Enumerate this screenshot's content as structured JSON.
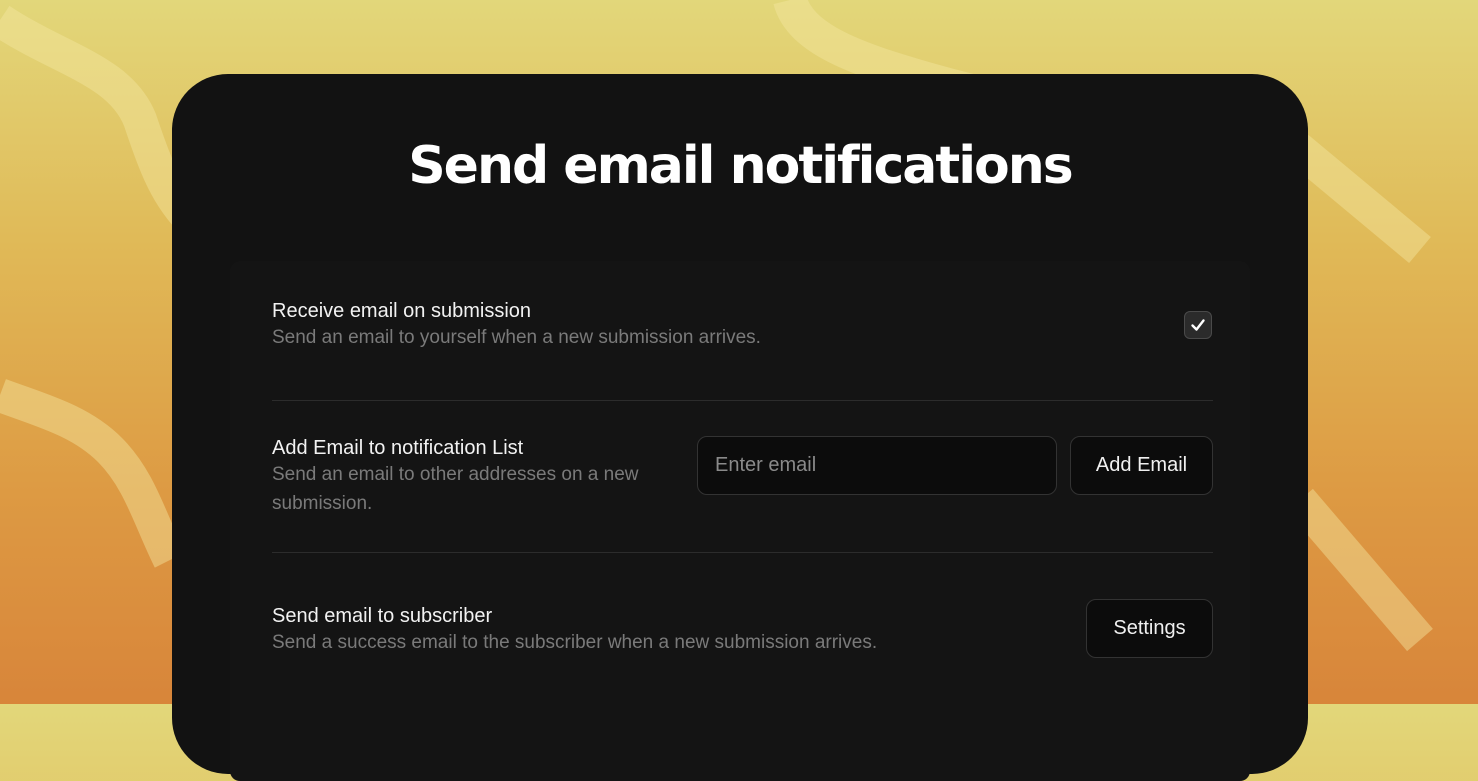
{
  "page": {
    "title": "Send email notifications"
  },
  "settings": [
    {
      "title": "Receive email on submission",
      "description": "Send an email to yourself when a new submission arrives.",
      "checked": true
    },
    {
      "title": "Add Email to notification List",
      "description": "Send an email to other addresses on a new submission.",
      "input_placeholder": "Enter email",
      "input_value": "",
      "button_label": "Add Email"
    },
    {
      "title": "Send email to subscriber",
      "description": "Send a success email to the subscriber when a new submission arrives.",
      "button_label": "Settings"
    }
  ],
  "icons": {
    "checkbox_checked": "checkmark-icon"
  },
  "colors": {
    "background_top": "#e2d77a",
    "background_bottom": "#d8853a",
    "card_background": "#121212",
    "text_primary": "#f2f2f2",
    "text_secondary": "#7a7a7a"
  }
}
